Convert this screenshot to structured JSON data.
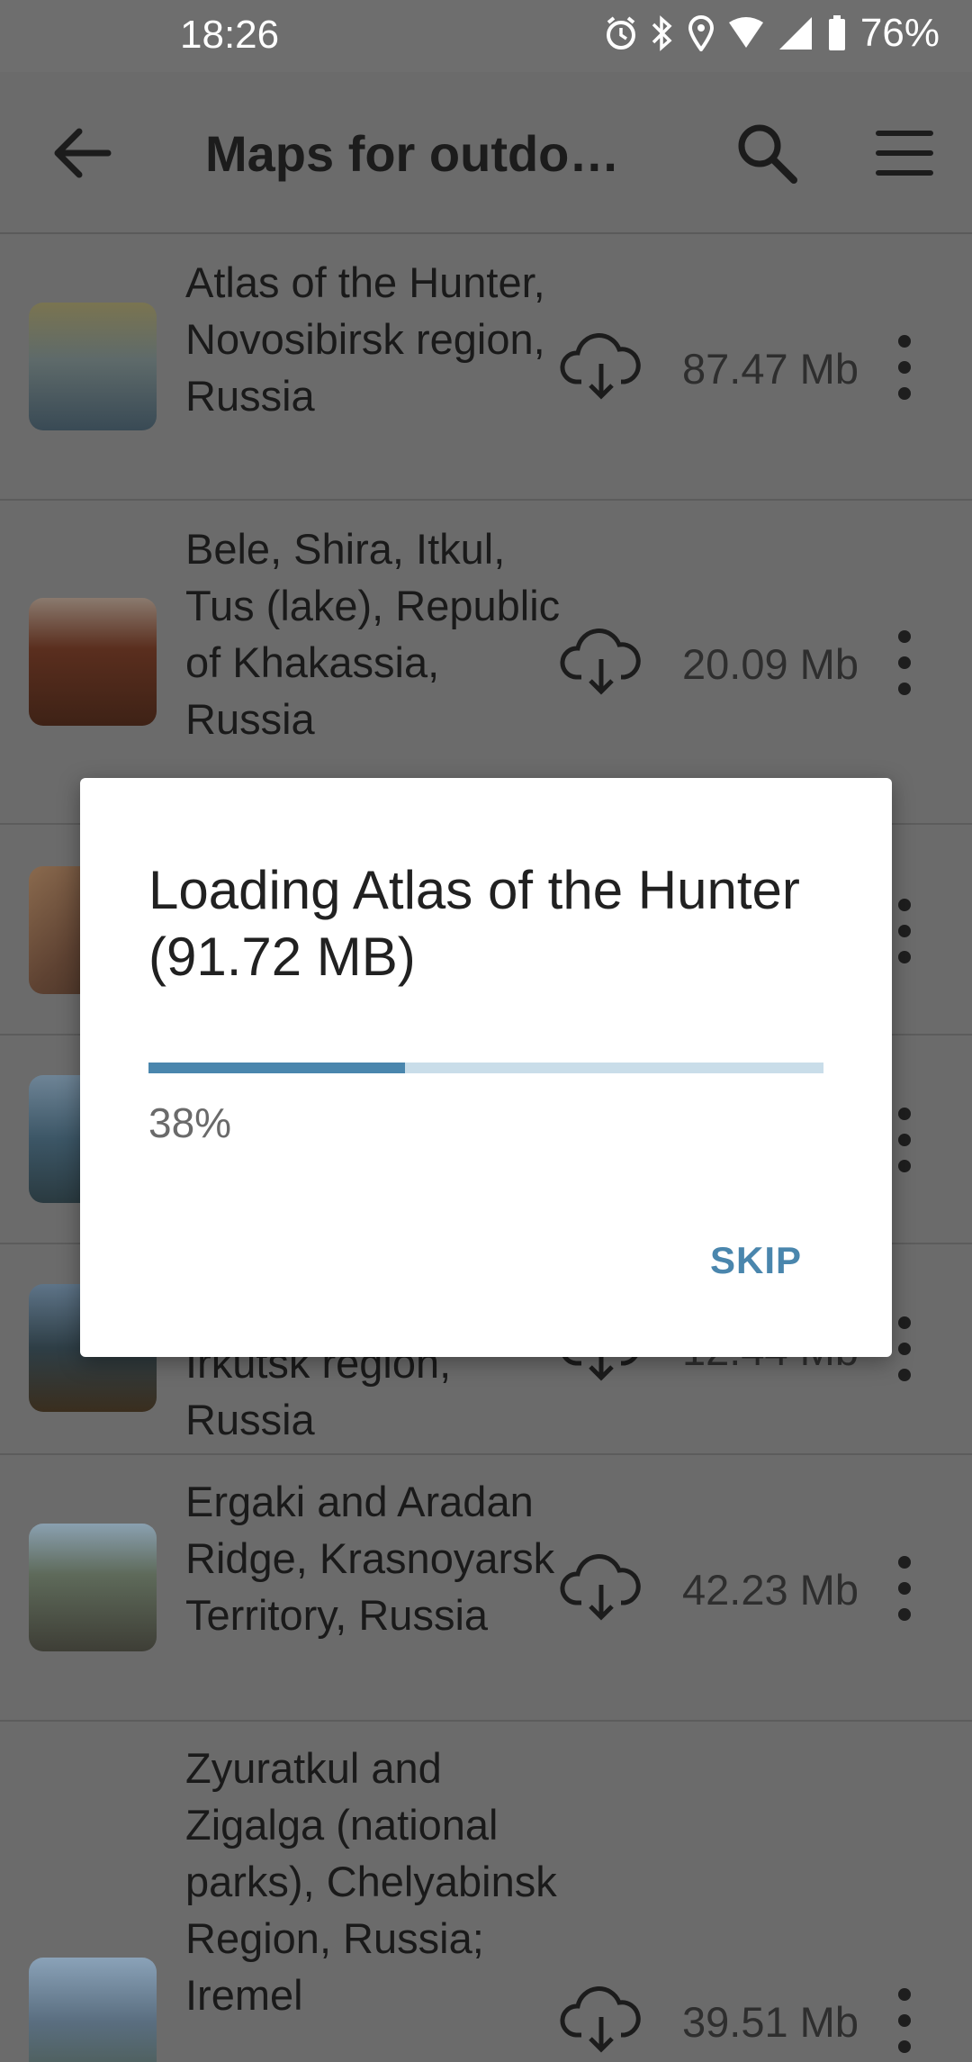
{
  "status_bar": {
    "time": "18:26",
    "battery": "76%"
  },
  "app_bar": {
    "title": "Maps for outdoor activities in Siberia"
  },
  "maps": [
    {
      "title": "Atlas of the Hunter, Novosibirsk region, Russia",
      "size": "87.47 Mb"
    },
    {
      "title": "Bele, Shira, Itkul, Tus (lake), Republic of Khakassia, Russia",
      "size": "20.09 Mb"
    },
    {
      "title": "",
      "size": ""
    },
    {
      "title": "",
      "size": ""
    },
    {
      "title": "Irkutsk region, Russia",
      "size": "12.44 Mb"
    },
    {
      "title": "Ergaki and Aradan Ridge, Krasnoyarsk Territory, Russia",
      "size": "42.23 Mb"
    },
    {
      "title": "Zyuratkul and Zigalga (national parks), Chelyabinsk Region, Russia; Iremel",
      "size": "39.51 Mb"
    }
  ],
  "dialog": {
    "title": "Loading Atlas of the Hunter (91.72 MB)",
    "progress_percent": 38,
    "progress_label": "38%",
    "skip_label": "SKIP"
  },
  "colors": {
    "accent": "#4a86ad",
    "progress_track": "#c9dde9"
  }
}
